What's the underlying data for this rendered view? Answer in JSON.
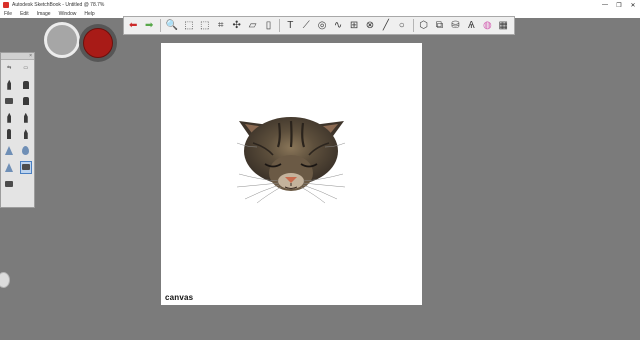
{
  "window": {
    "title": "Autodesk SketchBook - Untitled @ 78.7%",
    "controls": [
      "—",
      "❐",
      "✕"
    ]
  },
  "menu": [
    "File",
    "Edit",
    "Image",
    "Window",
    "Help"
  ],
  "toolbar": {
    "icons": [
      {
        "name": "undo-icon",
        "glyph": "⬅",
        "color": "#cc2a2a"
      },
      {
        "name": "redo-icon",
        "glyph": "➡",
        "color": "#58a84a"
      },
      {
        "name": "zoom-icon",
        "glyph": "🔍"
      },
      {
        "name": "select-icon",
        "glyph": "⬚"
      },
      {
        "name": "lasso-icon",
        "glyph": "⬚"
      },
      {
        "name": "crop-icon",
        "glyph": "⌗"
      },
      {
        "name": "transform-icon",
        "glyph": "✣"
      },
      {
        "name": "distort-icon",
        "glyph": "▱"
      },
      {
        "name": "layer-icon",
        "glyph": "▯"
      },
      {
        "name": "text-icon",
        "glyph": "T"
      },
      {
        "name": "ruler-icon",
        "glyph": "⟋"
      },
      {
        "name": "ellipse-guide-icon",
        "glyph": "◎"
      },
      {
        "name": "french-curve-icon",
        "glyph": "∿"
      },
      {
        "name": "perspective-icon",
        "glyph": "⊞"
      },
      {
        "name": "symmetry-icon",
        "glyph": "⊗"
      },
      {
        "name": "line-icon",
        "glyph": "╱"
      },
      {
        "name": "circle-icon",
        "glyph": "○"
      },
      {
        "name": "shape-icon",
        "glyph": "⬡"
      },
      {
        "name": "copy-icon",
        "glyph": "⧉"
      },
      {
        "name": "fill-icon",
        "glyph": "⛁"
      },
      {
        "name": "brush-library-icon",
        "glyph": "Ѧ"
      },
      {
        "name": "color-wheel-icon",
        "glyph": "◍",
        "color": "#d35ab0"
      },
      {
        "name": "layer-editor-icon",
        "glyph": "▦"
      }
    ]
  },
  "colors": {
    "primary": "#a81b17",
    "secondary": "#a6a6a6"
  },
  "brushes": {
    "selected_index": 13,
    "rows": [
      [
        "tag",
        "tag"
      ],
      [
        "pencil",
        "sq"
      ],
      [
        "wide",
        "sq"
      ],
      [
        "pencil",
        "pencil"
      ],
      [
        "nib",
        "pencil"
      ],
      [
        "tri",
        "drop"
      ],
      [
        "tri",
        "wide"
      ],
      [
        "wide",
        ""
      ]
    ]
  },
  "canvas": {
    "label": "canvas"
  }
}
